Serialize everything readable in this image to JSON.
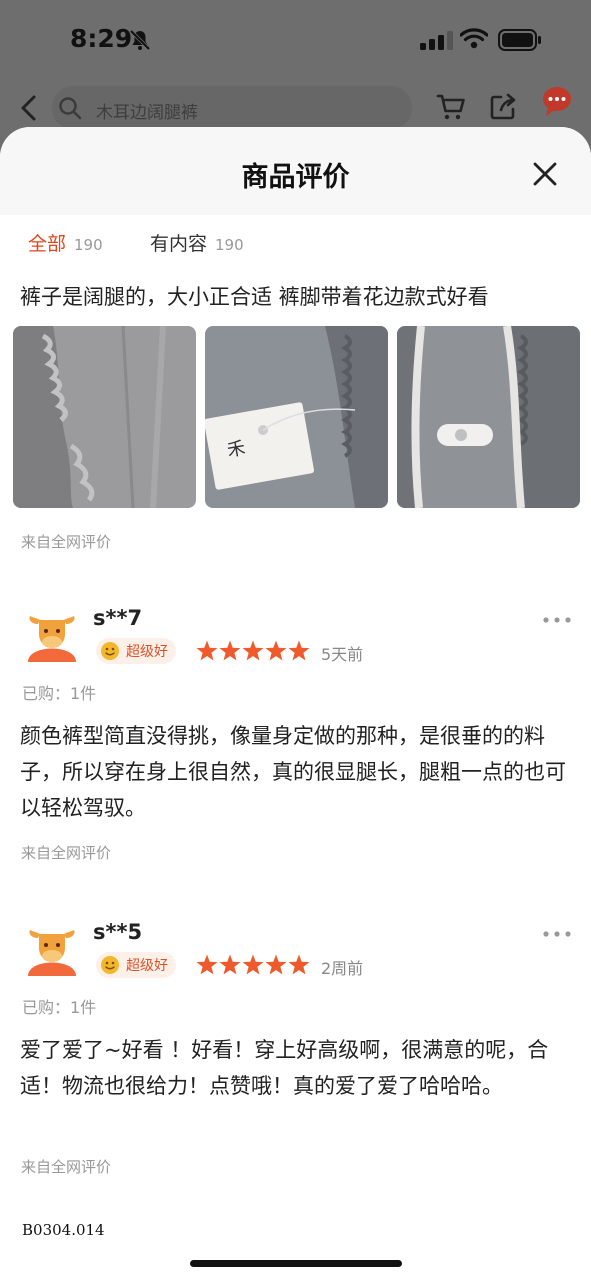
{
  "status_bar": {
    "time": "8:29"
  },
  "search": {
    "placeholder": "木耳边阔腿裤"
  },
  "sheet": {
    "title": "商品评价"
  },
  "tabs": [
    {
      "label": "全部",
      "count": "190"
    },
    {
      "label": "有内容",
      "count": "190"
    }
  ],
  "intro": {
    "text": "裤子是阔腿的，大小正合适 裤脚带着花边款式好看",
    "source": "来自全网评价"
  },
  "reviews": [
    {
      "username": "s**7",
      "badge": "超级好",
      "rating": 5,
      "date": "5天前",
      "bought": "已购：1件",
      "text": "颜色裤型简直没得挑，像量身定做的那种，是很垂的的料子，所以穿在身上很自然，真的很显腿长，腿粗一点的也可以轻松驾驭。",
      "source": "来自全网评价"
    },
    {
      "username": "s**5",
      "badge": "超级好",
      "rating": 5,
      "date": "2周前",
      "bought": "已购：1件",
      "text": "爱了爱了~好看 ！好看！穿上好高级啊，很满意的呢，合适！物流也很给力！点赞哦！真的爱了爱了哈哈哈。",
      "source": "来自全网评价"
    }
  ],
  "watermark": "B0304.014",
  "colors": {
    "accent": "#e0461f",
    "star": "#ee5a2c"
  }
}
